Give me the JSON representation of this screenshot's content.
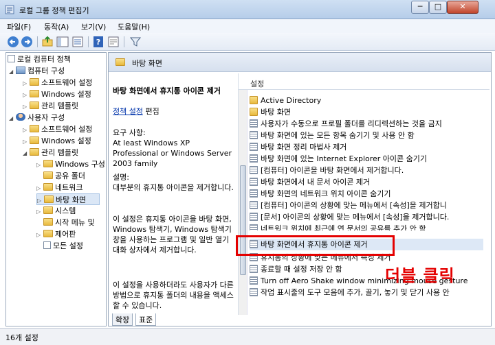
{
  "window": {
    "title": "로컬 그룹 정책 편집기",
    "min_label": "─",
    "max_label": "□",
    "close_label": "✕"
  },
  "menubar": {
    "items": [
      "파일(F)",
      "동작(A)",
      "보기(V)",
      "도움말(H)"
    ]
  },
  "toolbar": {
    "icons": [
      "back-arrow-icon",
      "forward-arrow-icon",
      "up-folder-icon",
      "show-hide-tree-icon",
      "export-list-icon",
      "help-icon",
      "properties-icon",
      "filter-icon"
    ]
  },
  "tree": {
    "items": [
      "로컬 컴퓨터 정책",
      "컴퓨터 구성",
      "소프트웨어 설정",
      "Windows 설정",
      "관리 템플릿",
      "사용자 구성",
      "소프트웨어 설정",
      "Windows 설정",
      "관리 템플릿",
      "Windows 구성",
      "공유 폴더",
      "네트워크",
      "바탕 화면",
      "시스템",
      "시작 메뉴 및",
      "제어판",
      "모든 설정"
    ]
  },
  "detail": {
    "header": "바탕 화면",
    "policy_title": "바탕 화면에서 휴지통 아이콘 제거",
    "edit_link": "정책 설정",
    "edit_suffix": "편집",
    "requirement": "요구 사항:\nAt least Windows XP Professional or Windows Server 2003 family",
    "description": "설명:\n대부분의 휴지통 아이콘을 제거합니다.",
    "para1": "이 설정은 휴지통 아이콘을 바탕 화면, Windows 탐색기, Windows 탐색기 창을 사용하는 프로그램 및 일반 열기 대화 상자에서 제거합니다.",
    "para2": "이 설정을 사용하더라도 사용자가 다른 방법으로 휴지통 폴더의 내용을 액세스할 수 있습니다."
  },
  "list": {
    "column_header": "설정",
    "rows": [
      "Active Directory",
      "바탕 화면",
      "사용자가 수동으로 프로필 폴더를 리디렉션하는 것을 금지",
      "바탕 화면에 있는 모든 항목 숨기기 및 사용 안 함",
      "바탕 화면 정리 마법사 제거",
      "바탕 화면에 있는 Internet Explorer 아이콘 숨기기",
      "[컴퓨터] 아이콘을 바탕 화면에서 제거합니다.",
      "바탕 화면에서 내 문서 아이콘 제거",
      "바탕 화면의 네트워크 위치 아이콘 숨기기",
      "[컴퓨터] 아이콘의 상황에 맞는 메뉴에서 [속성]을 제거합니",
      "[문서] 아이콘의 상황에 맞는 메뉴에서 [속성]을 제거합니다.",
      "네트워크 위치에 최근에 연 문서의 공유를 추가 안 함",
      "바탕 화면에서 휴지통 아이콘 제거",
      "휴지통의 상황에 맞는 메뉴에서 속성 제거",
      "종료할 때 설정 저장 안 함",
      "Turn off Aero Shake window minimizing mouse gesture",
      "작업 표시줄의 도구 모음에 추가, 끌기, 놓기 및 닫기 사용 안"
    ]
  },
  "annotation": "더블 클릭",
  "tabs": [
    "확장",
    "표준"
  ],
  "status": "16개 설정",
  "colors": {
    "highlight": "#e40000",
    "selection": "#dbe7f6"
  }
}
